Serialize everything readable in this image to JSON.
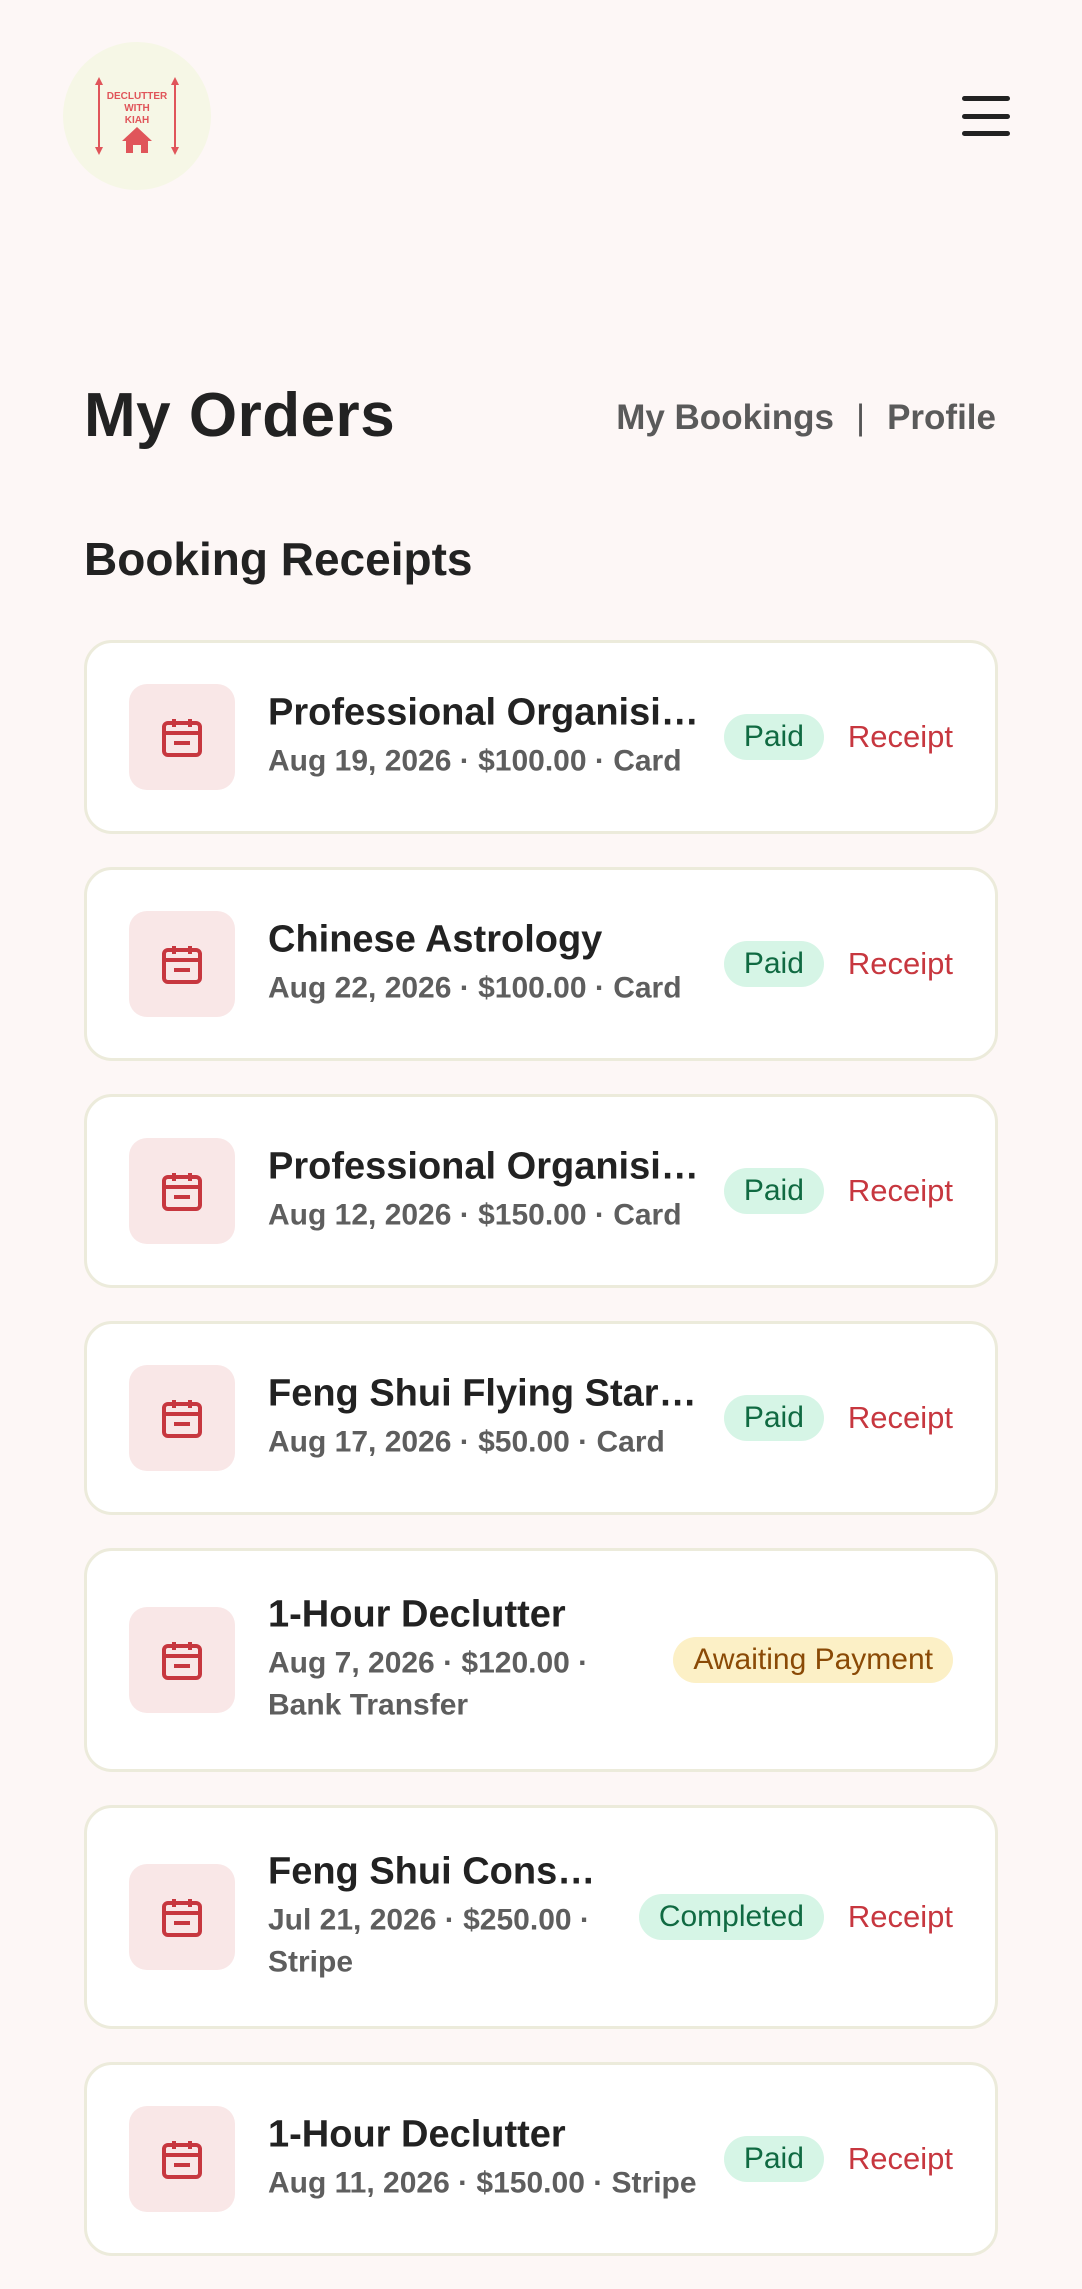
{
  "header": {
    "logo_text_line1": "DECLUTTER",
    "logo_text_line2": "WITH",
    "logo_text_line3": "KIAH"
  },
  "page": {
    "title": "My Orders",
    "links": {
      "bookings": "My Bookings",
      "separator": "|",
      "profile": "Profile"
    },
    "section_title": "Booking Receipts"
  },
  "orders": [
    {
      "title": "Professional Organisin…",
      "meta": "Aug 19, 2026 · $100.00 · Card",
      "status": "Paid",
      "action": "Receipt"
    },
    {
      "title": "Chinese Astrology",
      "meta": "Aug 22, 2026 · $100.00 · Card",
      "status": "Paid",
      "action": "Receipt"
    },
    {
      "title": "Professional Organisin…",
      "meta": "Aug 12, 2026 · $150.00 · Card",
      "status": "Paid",
      "action": "Receipt"
    },
    {
      "title": "Feng Shui Flying Stars …",
      "meta": "Aug 17, 2026 · $50.00 · Card",
      "status": "Paid",
      "action": "Receipt"
    },
    {
      "title": "1-Hour Declutter",
      "meta_line1": "Aug 7, 2026 · $120.00 ·",
      "meta_line2": "Bank Transfer",
      "status": "Awaiting Payment"
    },
    {
      "title": "Feng Shui Consul…",
      "meta_line1": "Jul 21, 2026 · $250.00 ·",
      "meta_line2": "Stripe",
      "status": "Completed",
      "action": "Receipt"
    },
    {
      "title": "1-Hour Declutter",
      "meta": "Aug 11, 2026 · $150.00 · Stripe",
      "status": "Paid",
      "action": "Receipt"
    }
  ],
  "colors": {
    "background": "#fdf7f6",
    "accent": "#c7373f",
    "paid_bg": "#d6f5e6",
    "paid_text": "#106a42",
    "awaiting_bg": "#fcf0c6",
    "awaiting_text": "#8a4a06"
  },
  "icons": {
    "menu": "hamburger-menu-icon",
    "order": "calendar-icon",
    "logo_house": "house-icon"
  }
}
